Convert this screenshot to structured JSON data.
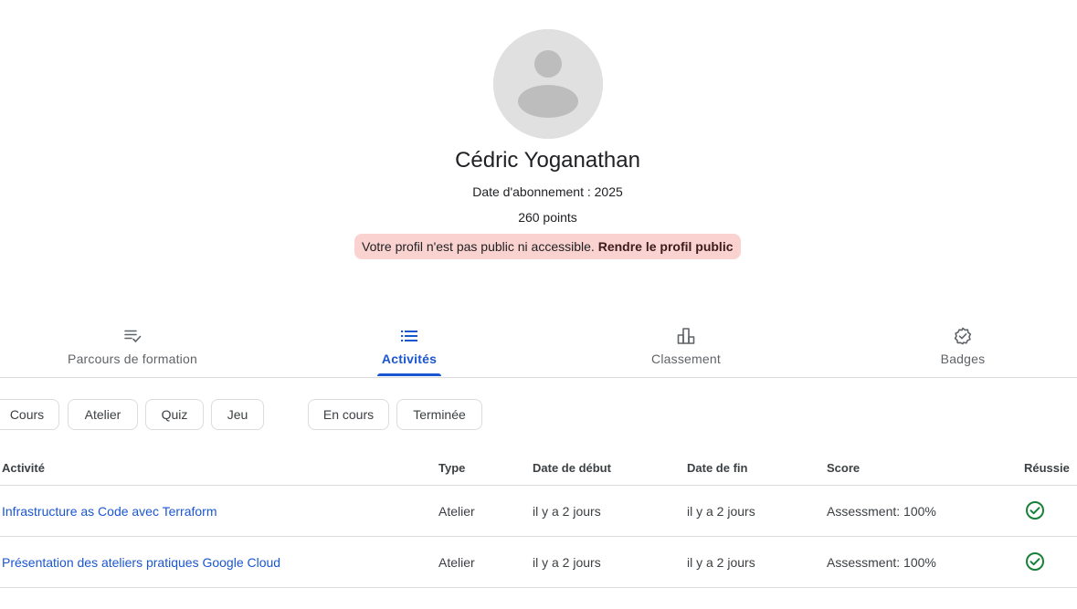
{
  "profile": {
    "name": "Cédric Yoganathan",
    "member_since": "Date d'abonnement : 2025",
    "points": "260 points",
    "notice_text": "Votre profil n'est pas public ni accessible.",
    "notice_link": "Rendre le profil public"
  },
  "tabs": [
    {
      "label": "Parcours de formation",
      "icon": "playlist-check-icon",
      "active": false
    },
    {
      "label": "Activités",
      "icon": "list-icon",
      "active": true
    },
    {
      "label": "Classement",
      "icon": "leaderboard-icon",
      "active": false
    },
    {
      "label": "Badges",
      "icon": "badge-check-icon",
      "active": false
    }
  ],
  "filters": {
    "type_chips": [
      "Cours",
      "Atelier",
      "Quiz",
      "Jeu"
    ],
    "status_chips": [
      "En cours",
      "Terminée"
    ]
  },
  "table": {
    "headers": [
      "Activité",
      "Type",
      "Date de début",
      "Date de fin",
      "Score",
      "Réussie"
    ],
    "rows": [
      {
        "activity": "Infrastructure as Code avec Terraform",
        "type": "Atelier",
        "start": "il y a 2 jours",
        "end": "il y a 2 jours",
        "score": "Assessment: 100%",
        "passed_icon": "check-circle-icon"
      },
      {
        "activity": "Présentation des ateliers pratiques Google Cloud",
        "type": "Atelier",
        "start": "il y a 2 jours",
        "end": "il y a 2 jours",
        "score": "Assessment: 100%",
        "passed_icon": "check-circle-icon"
      }
    ]
  },
  "colors": {
    "accent": "#1a56d1",
    "notice_bg": "#fad2cf",
    "success": "#188038",
    "divider": "#dadce0"
  }
}
